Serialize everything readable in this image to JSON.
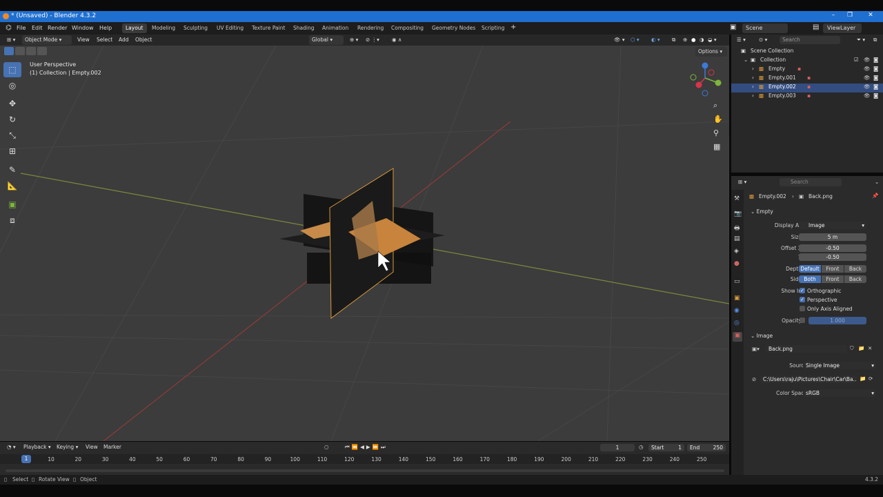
{
  "title": "* (Unsaved) - Blender 4.3.2",
  "menu": [
    "File",
    "Edit",
    "Render",
    "Window",
    "Help"
  ],
  "workspaces": [
    "Layout",
    "Modeling",
    "Sculpting",
    "UV Editing",
    "Texture Paint",
    "Shading",
    "Animation",
    "Rendering",
    "Compositing",
    "Geometry Nodes",
    "Scripting"
  ],
  "scene": "Scene",
  "view_layer": "ViewLayer",
  "vp_header": {
    "mode": "Object Mode",
    "view": "View",
    "select": "Select",
    "add": "Add",
    "object": "Object",
    "orientation": "Global",
    "options": "Options"
  },
  "overlay": {
    "perspective": "User Perspective",
    "collection": "(1) Collection | Empty.002"
  },
  "outliner": {
    "root": "Scene Collection",
    "collection": "Collection",
    "items": [
      "Empty",
      "Empty.001",
      "Empty.002",
      "Empty.003"
    ],
    "search": "Search"
  },
  "props": {
    "search": "Search",
    "breadcrumb_obj": "Empty.002",
    "breadcrumb_img": "Back.png",
    "empty_section": "Empty",
    "display_as_label": "Display As",
    "display_as": "Image",
    "size_label": "Size",
    "size": "5 m",
    "offset_x_label": "Offset X",
    "offset_x": "-0.50",
    "offset_y_label": "Y",
    "offset_y": "-0.50",
    "depth_label": "Depth",
    "depth": [
      "Default",
      "Front",
      "Back"
    ],
    "side_label": "Side",
    "side": [
      "Both",
      "Front",
      "Back"
    ],
    "show_in_label": "Show In",
    "orthographic": "Orthographic",
    "perspective": "Perspective",
    "axis_aligned": "Only Axis Aligned",
    "opacity_label": "Opacity",
    "opacity": "1.000",
    "image_section": "Image",
    "image_name": "Back.png",
    "source_label": "Source",
    "source": "Single Image",
    "path": "C:\\Users\\raju\\Pictures\\Chair\\Car\\Ba...",
    "color_space_label": "Color Space",
    "color_space": "sRGB"
  },
  "timeline": {
    "playback": "Playback",
    "keying": "Keying",
    "view": "View",
    "marker": "Marker",
    "current": "1",
    "start_label": "Start",
    "start": "1",
    "end_label": "End",
    "end": "250",
    "frame_marker": "1",
    "ticks": [
      "10",
      "20",
      "30",
      "40",
      "50",
      "60",
      "70",
      "80",
      "90",
      "100",
      "110",
      "120",
      "130",
      "140",
      "150",
      "160",
      "170",
      "180",
      "190",
      "200",
      "210",
      "220",
      "230",
      "240",
      "250"
    ]
  },
  "status": {
    "select": "Select",
    "rotate": "Rotate View",
    "object": "Object",
    "version": "4.3.2"
  },
  "colors": {
    "accent": "#4772b3",
    "title_bar": "#1f6fd0",
    "selection": "#334d80"
  }
}
